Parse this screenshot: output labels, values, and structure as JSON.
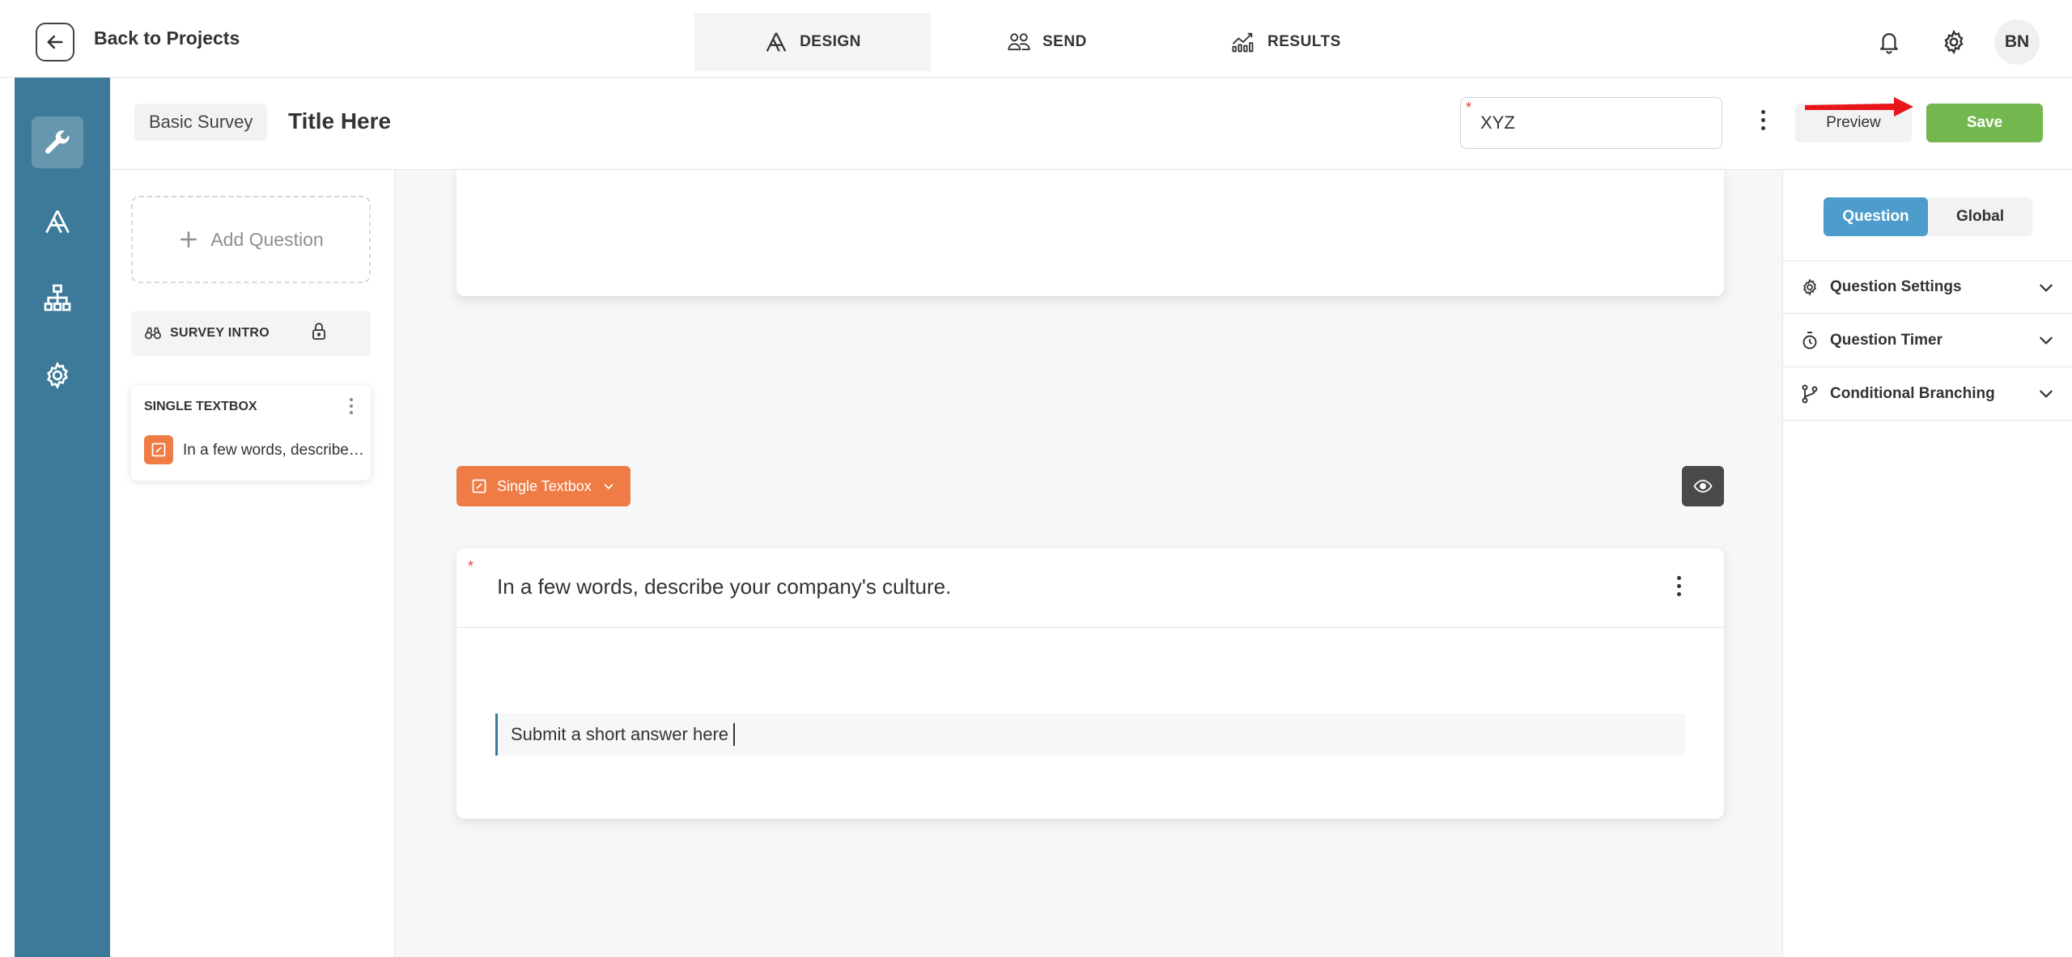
{
  "topbar": {
    "back_label": "Back to Projects",
    "tabs": [
      {
        "label": "DESIGN",
        "icon": "design-icon",
        "active": true
      },
      {
        "label": "SEND",
        "icon": "people-icon",
        "active": false
      },
      {
        "label": "RESULTS",
        "icon": "results-chart-icon",
        "active": false
      }
    ],
    "avatar_initials": "BN"
  },
  "rail": {
    "items": [
      {
        "name": "wrench-icon",
        "active": true
      },
      {
        "name": "design-icon",
        "active": false
      },
      {
        "name": "sitemap-icon",
        "active": false
      },
      {
        "name": "gear-icon",
        "active": false
      }
    ]
  },
  "header": {
    "survey_type": "Basic Survey",
    "title": "Title Here",
    "name_input_value": "XYZ",
    "preview_label": "Preview",
    "save_label": "Save"
  },
  "question_list": {
    "add_label": "Add Question",
    "intro_label": "SURVEY INTRO",
    "items": [
      {
        "type": "SINGLE TEXTBOX",
        "text": "In a few words, describe your company's culture."
      }
    ]
  },
  "canvas": {
    "type_pill_label": "Single Textbox",
    "question_text": "In a few words, describe your company's culture.",
    "answer_placeholder": "Submit a short answer here"
  },
  "right_panel": {
    "segments": [
      {
        "label": "Question",
        "active": true
      },
      {
        "label": "Global",
        "active": false
      }
    ],
    "sections": [
      {
        "label": "Question Settings",
        "icon": "gear-icon"
      },
      {
        "label": "Question Timer",
        "icon": "timer-icon"
      },
      {
        "label": "Conditional Branching",
        "icon": "branch-icon"
      }
    ]
  },
  "colors": {
    "rail": "#3d7a99",
    "accent_orange": "#ef7b45",
    "save_green": "#74b74f",
    "segment_blue": "#4d9ccc",
    "annotation_red": "#e8161b"
  }
}
